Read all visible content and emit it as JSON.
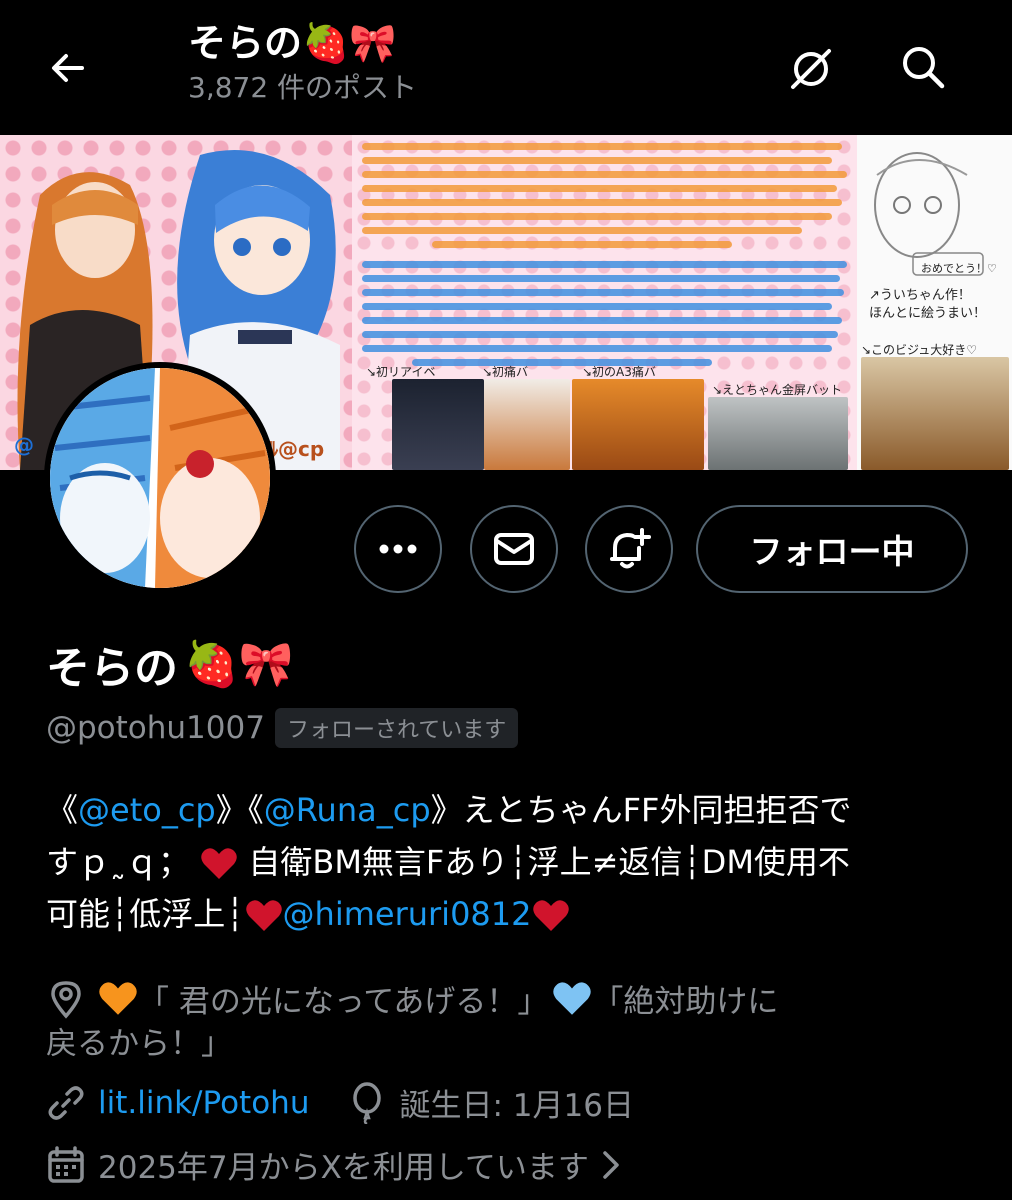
{
  "header": {
    "title": "そらの🍓🎀",
    "post_count": "3,872 件のポスト"
  },
  "banner": {
    "tag_left": "@",
    "tag_right": "ﾙ@cp",
    "caption_congrats": "おめでとう！♡",
    "caption_drawing": "↗ういちゃん作！\nほんとに絵うまい！",
    "caption_bisu": "↘このビジュ大好き♡",
    "caption_photo1": "↘初リアイベ",
    "caption_photo2": "↘初痛バ",
    "caption_photo3": "↘初のA3痛バ",
    "caption_photo4": "↘えとちゃん金屏バット"
  },
  "actions": {
    "follow_label": "フォロー中"
  },
  "profile": {
    "name": "そらの",
    "name_emoji": "🍓🎀",
    "handle": "@potohu1007",
    "follows_you": "フォローされています",
    "bio": {
      "l1_a": "《",
      "l1_mention1": "@eto_cp",
      "l1_b": "》《",
      "l1_mention2": "@Runa_cp",
      "l1_c": "》えとちゃんFF外同担拒否で",
      "l2_a": "すｐ˷ｑ；",
      "l2_b": "自衛BM無言Fあり┆浮上≠返信┆DM使用不",
      "l3_a": "可能┆低浮上┆",
      "l3_mention": "@himeruri0812"
    },
    "location_a": "「 君の光になってあげる！」",
    "location_b": "「絶対助けに",
    "location_c": "戻るから！」",
    "website": "lit.link/Potohu",
    "birthday": "誕生日: 1月16日",
    "joined": "2025年7月からXを利用しています"
  },
  "colors": {
    "accent": "#1d9bf0",
    "heart_red": "#d0142c",
    "heart_orange": "#f7941d",
    "heart_blue": "#7ec3f3"
  }
}
